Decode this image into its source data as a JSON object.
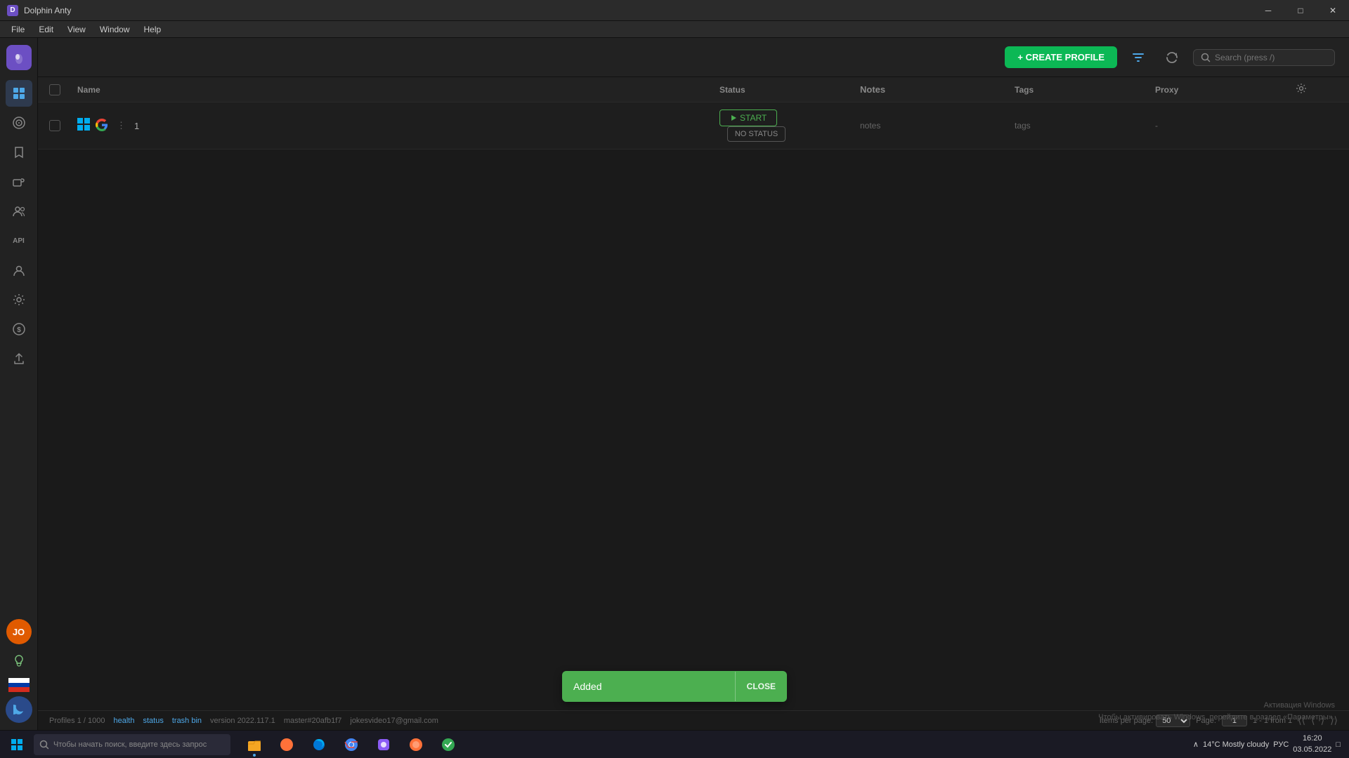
{
  "titleBar": {
    "appName": "Dolphin Anty",
    "controls": {
      "minimize": "─",
      "maximize": "□",
      "close": "✕"
    }
  },
  "menuBar": {
    "items": [
      "File",
      "Edit",
      "View",
      "Window",
      "Help"
    ]
  },
  "toolbar": {
    "createBtn": "+ CREATE PROFILE",
    "searchPlaceholder": "Search (press /)"
  },
  "table": {
    "columns": [
      "Name",
      "Status",
      "Notes",
      "Tags",
      "Proxy"
    ],
    "rows": [
      {
        "id": 1,
        "name": "1",
        "status": "NO STATUS",
        "notes": "notes",
        "tags": "tags",
        "proxy": "-"
      }
    ]
  },
  "statusBar": {
    "profilesInfo": "Profiles 1 / 1000",
    "health": "health",
    "status": "status",
    "trashBin": "trash bin",
    "version": "version 2022.117.1",
    "branch": "master#20afb1f7",
    "user": "jokesvideo17@gmail.com",
    "pagination": {
      "itemsPerPageLabel": "Items per page:",
      "itemsPerPage": "50",
      "pageLabel": "Page:",
      "pageNum": "1",
      "pageInfo": "1 - 1 from 1"
    }
  },
  "toast": {
    "message": "Added",
    "closeLabel": "CLOSE"
  },
  "taskbar": {
    "searchPlaceholder": "Чтобы начать поиск, введите здесь запрос",
    "weather": "14°C  Mostly cloudy",
    "time": "16:20",
    "date": "03.05.2022",
    "language": "РУС"
  },
  "sidebar": {
    "logo": "D",
    "avatar": "JO",
    "items": [
      {
        "id": "profiles",
        "icon": "▦",
        "label": "Profiles"
      },
      {
        "id": "cookies",
        "icon": "◎",
        "label": "Cookies"
      },
      {
        "id": "bookmarks",
        "icon": "⚑",
        "label": "Bookmarks"
      },
      {
        "id": "extensions",
        "icon": "⊞",
        "label": "Extensions"
      },
      {
        "id": "team",
        "icon": "👤",
        "label": "Team"
      },
      {
        "id": "api",
        "icon": "API",
        "label": "API"
      },
      {
        "id": "accounts",
        "icon": "👤",
        "label": "Accounts"
      },
      {
        "id": "settings",
        "icon": "⚙",
        "label": "Settings"
      },
      {
        "id": "billing",
        "icon": "$",
        "label": "Billing"
      },
      {
        "id": "export",
        "icon": "↗",
        "label": "Export"
      }
    ]
  },
  "winWatermark": {
    "line1": "Активация Windows",
    "line2": "Чтобы активировать Windows, перейдите в раздел «Параметры»."
  }
}
